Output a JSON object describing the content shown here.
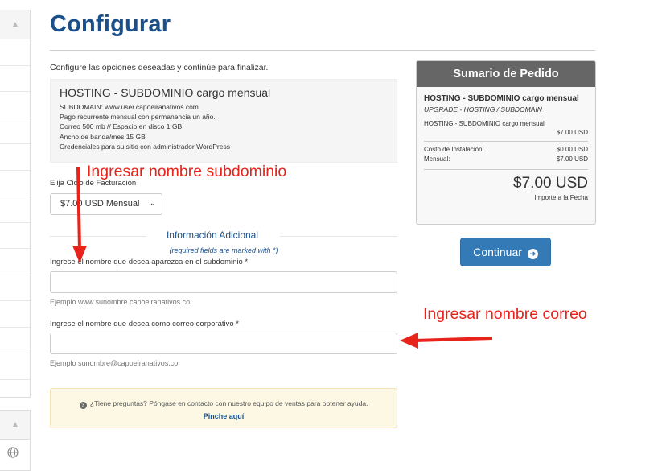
{
  "page": {
    "title": "Configurar",
    "intro": "Configure las opciones deseadas y continúe para finalizar."
  },
  "product": {
    "name": "HOSTING - SUBDOMINIO cargo mensual",
    "details": [
      "SUBDOMAIN: www.user.capoeiranativos.com",
      "Pago recurrente mensual con permanencia un año.",
      "Correo 500 mb // Espacio en disco 1 GB",
      "Ancho de banda/mes 15 GB",
      "Credenciales para su sitio con administrador WordPress"
    ]
  },
  "billing": {
    "label": "Elija Ciclo de Facturación",
    "selected": "$7.00 USD Mensual"
  },
  "additional_info": {
    "title": "Información Adicional",
    "required_note": "(required fields are marked with *)",
    "fields": [
      {
        "label": "Ingrese el nombre que desea aparezca en el subdominio *",
        "value": "",
        "help": "Ejemplo www.sunombre.capoeiranativos.co"
      },
      {
        "label": "Ingrese el nombre que desea como correo corporativo *",
        "value": "",
        "help": "Ejemplo sunombre@capoeiranativos.co"
      }
    ]
  },
  "help_box": {
    "text": "¿Tiene preguntas? Póngase en contacto con nuestro equipo de ventas para obtener ayuda.",
    "link": "Pinche aquí"
  },
  "summary": {
    "title": "Sumario de Pedido",
    "product": "HOSTING - SUBDOMINIO cargo mensual",
    "group": "UPGRADE - HOSTING / SUBDOMAIN",
    "item": "HOSTING - SUBDOMINIO cargo mensual",
    "item_price": "$7.00 USD",
    "setup_label": "Costo de Instalación:",
    "setup_value": "$0.00 USD",
    "monthly_label": "Mensual:",
    "monthly_value": "$7.00 USD",
    "total": "$7.00 USD",
    "total_label": "Importe a la Fecha"
  },
  "continue_button": {
    "label": "Continuar"
  },
  "annotations": {
    "subdomain": "Ingresar nombre subdominio",
    "email": "Ingresar nombre correo",
    "color": "#e8231b"
  },
  "colors": {
    "title": "#1a4f8a",
    "primary_button": "#337ab7",
    "summary_header": "#666666",
    "help_box_bg": "#fcf8e3"
  },
  "icons": {
    "question": "question-circle-icon",
    "arrow_right": "arrow-circle-right-icon",
    "globe": "globe-icon",
    "chevron": "chevron-up-icon"
  }
}
